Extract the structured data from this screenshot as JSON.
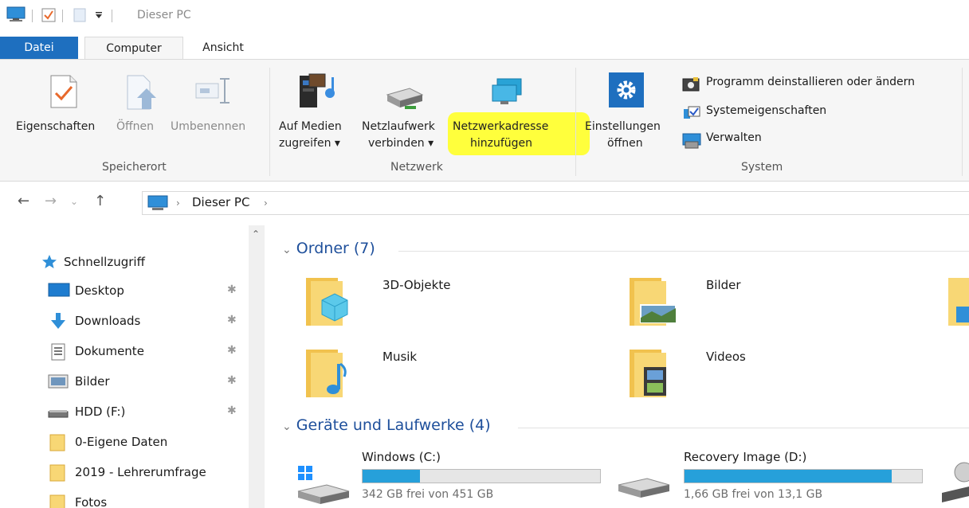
{
  "window": {
    "title": "Dieser PC"
  },
  "tabs": {
    "file": "Datei",
    "computer": "Computer",
    "view": "Ansicht"
  },
  "ribbon": {
    "properties": "Eigenschaften",
    "open": "Öffnen",
    "rename": "Umbenennen",
    "media_line1": "Auf Medien",
    "media_line2": "zugreifen ▾",
    "netdrive_line1": "Netzlaufwerk",
    "netdrive_line2": "verbinden ▾",
    "netaddr_line1": "Netzwerkadresse",
    "netaddr_line2": "hinzufügen",
    "settings_line1": "Einstellungen",
    "settings_line2": "öffnen",
    "uninstall": "Programm deinstallieren oder ändern",
    "sysprops": "Systemeigenschaften",
    "manage": "Verwalten",
    "group_location": "Speicherort",
    "group_network": "Netzwerk",
    "group_system": "System",
    "highlight_color": "#ffff3c"
  },
  "address": {
    "location": "Dieser PC"
  },
  "sidebar": {
    "items": [
      {
        "label": "Schnellzugriff",
        "icon": "star-icon"
      },
      {
        "label": "Desktop",
        "icon": "desktop-icon",
        "pinned": true
      },
      {
        "label": "Downloads",
        "icon": "download-icon",
        "pinned": true
      },
      {
        "label": "Dokumente",
        "icon": "document-icon",
        "pinned": true
      },
      {
        "label": "Bilder",
        "icon": "pictures-icon",
        "pinned": true
      },
      {
        "label": "HDD (F:)",
        "icon": "drive-icon",
        "pinned": true
      },
      {
        "label": "0-Eigene Daten",
        "icon": "folder-icon"
      },
      {
        "label": "2019 - Lehrerumfrage",
        "icon": "folder-icon"
      },
      {
        "label": "Fotos",
        "icon": "folder-icon"
      }
    ]
  },
  "content": {
    "folders_header": "Ordner (7)",
    "drives_header": "Geräte und Laufwerke (4)",
    "folders": [
      {
        "name": "3D-Objekte",
        "icon": "3d-objects-folder-icon"
      },
      {
        "name": "Bilder",
        "icon": "pictures-folder-icon"
      },
      {
        "name": "Musik",
        "icon": "music-folder-icon"
      },
      {
        "name": "Videos",
        "icon": "videos-folder-icon"
      }
    ],
    "drives": [
      {
        "name": "Windows (C:)",
        "free": "342 GB frei von 451 GB",
        "used_fraction": 0.242
      },
      {
        "name": "Recovery Image (D:)",
        "free": "1,66 GB frei von 13,1 GB",
        "used_fraction": 0.873
      }
    ],
    "accent": "#26a0da"
  }
}
